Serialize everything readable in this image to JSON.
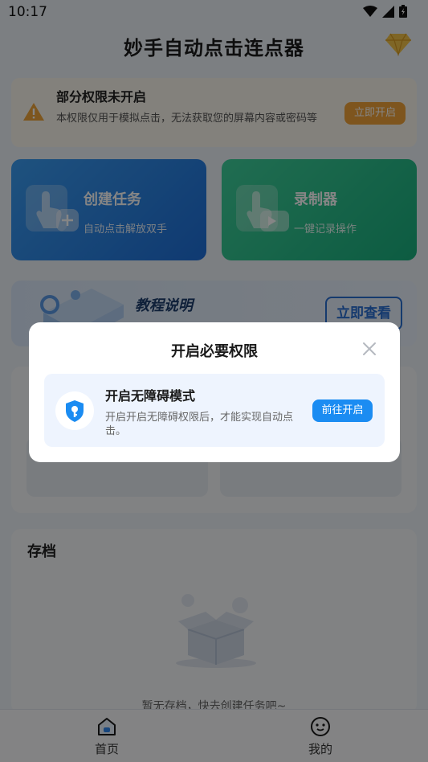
{
  "status_bar": {
    "time": "10:17"
  },
  "app": {
    "title": "妙手自动点击连点器"
  },
  "permission_banner": {
    "title": "部分权限未开启",
    "description": "本权限仅用于模拟点击，无法获取您的屏幕内容或密码等",
    "button_label": "立即开启"
  },
  "cards": [
    {
      "title": "创建任务",
      "subtitle": "自动点击解放双手"
    },
    {
      "title": "录制器",
      "subtitle": "一键记录操作"
    }
  ],
  "tutorial": {
    "title": "教程说明",
    "button_label": "立即查看"
  },
  "archive": {
    "title": "存档",
    "empty_text": "暂无存档，快去创建任务吧~"
  },
  "bottom_nav": [
    {
      "label": "首页",
      "icon": "home-icon"
    },
    {
      "label": "我的",
      "icon": "profile-icon"
    }
  ],
  "dialog": {
    "title": "开启必要权限",
    "item": {
      "title": "开启无障碍模式",
      "description": "开启开启无障碍权限后，才能实现自动点击。",
      "button_label": "前往开启",
      "icon": "shield-key-icon"
    }
  },
  "colors": {
    "primary": "#1b8cf2",
    "warning": "#f1a43a",
    "create_card": "#2a86e6",
    "record_card": "#2cc18d"
  }
}
